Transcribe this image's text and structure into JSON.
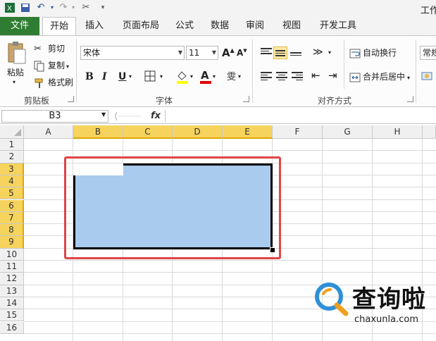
{
  "window": {
    "title_partial": "工作"
  },
  "tabs": [
    "文件",
    "开始",
    "插入",
    "页面布局",
    "公式",
    "数据",
    "审阅",
    "视图",
    "开发工具"
  ],
  "ribbon": {
    "clipboard": {
      "paste": "粘贴",
      "cut": "剪切",
      "copy": "复制",
      "format_painter": "格式刷",
      "group_label": "剪贴板"
    },
    "font": {
      "font_name": "宋体",
      "font_size": "11",
      "bold": "B",
      "italic": "I",
      "underline": "U",
      "group_label": "字体"
    },
    "alignment": {
      "wrap_text": "自动换行",
      "merge_center": "合并后居中",
      "group_label": "对齐方式"
    },
    "number": {
      "format": "常规"
    }
  },
  "formula_bar": {
    "name_box": "B3",
    "fx_label": "fx",
    "formula": ""
  },
  "sheet": {
    "columns": [
      "A",
      "B",
      "C",
      "D",
      "E",
      "F",
      "G",
      "H"
    ],
    "selected_columns": [
      "B",
      "C",
      "D",
      "E"
    ],
    "rows": [
      "1",
      "2",
      "3",
      "4",
      "5",
      "6",
      "7",
      "8",
      "9",
      "10",
      "11",
      "12",
      "13",
      "14",
      "15",
      "16"
    ],
    "selected_rows": [
      "3",
      "4",
      "5",
      "6",
      "7",
      "8",
      "9"
    ],
    "selection_range": "B3:E9",
    "selection_color": "#a9ccee",
    "highlight_color": "#e04545"
  },
  "watermark": {
    "title": "查询啦",
    "url": "chaxunla.com"
  },
  "colors": {
    "file_tab": "#2f7d32",
    "header_selected": "#f5d35d"
  }
}
